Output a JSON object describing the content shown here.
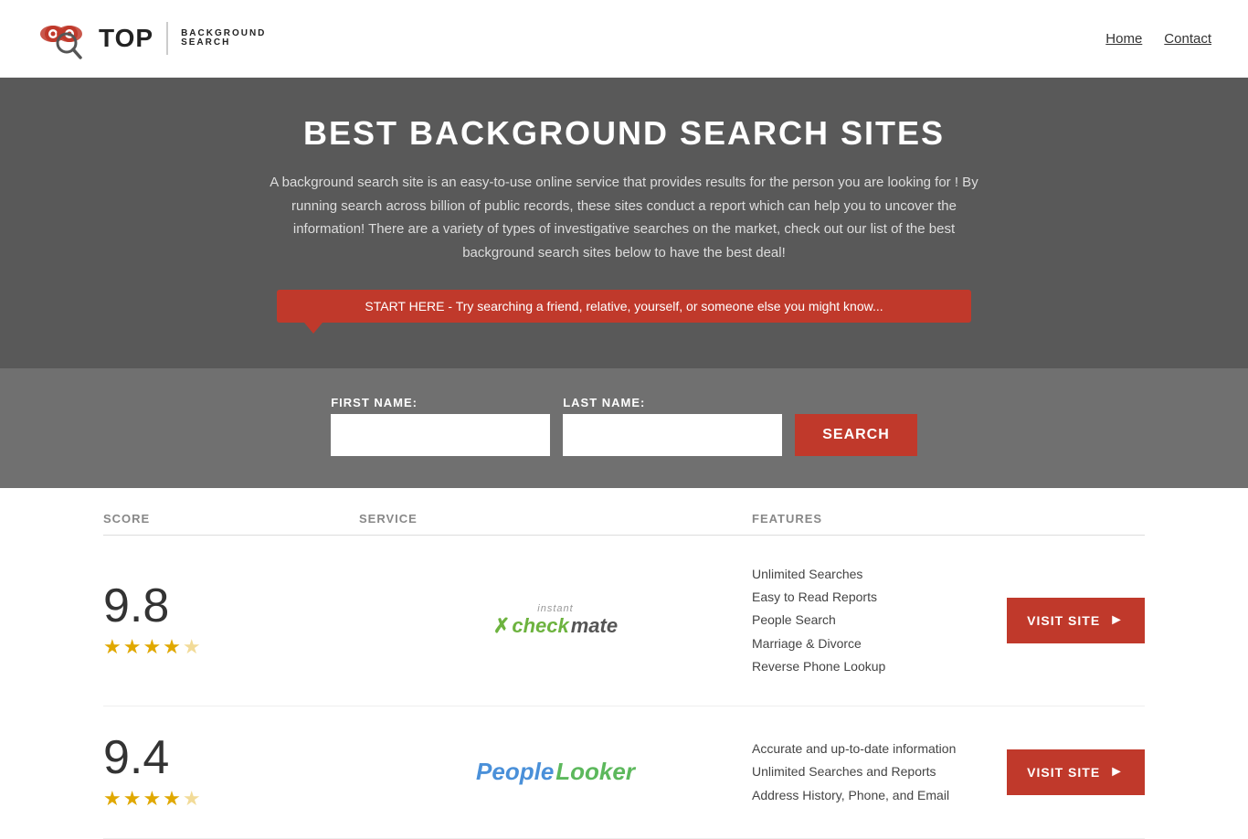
{
  "header": {
    "logo_top": "TOP",
    "logo_sub_line1": "BACKGROUND",
    "logo_sub_line2": "SEARCH",
    "nav": [
      {
        "label": "Home",
        "href": "#"
      },
      {
        "label": "Contact",
        "href": "#"
      }
    ]
  },
  "hero": {
    "title": "BEST BACKGROUND SEARCH SITES",
    "description": "A background search site is an easy-to-use online service that provides results  for the person you are looking for ! By  running  search across billion of public records, these sites conduct  a report which can help you to uncover the information! There are a variety of types of investigative searches on the market, check out our  list of the best background search sites below to have the best deal!",
    "speech_bubble": "START HERE - Try searching a friend, relative, yourself, or someone else you might know..."
  },
  "search": {
    "first_name_label": "FIRST NAME:",
    "last_name_label": "LAST NAME:",
    "button_label": "SEARCH"
  },
  "table": {
    "headers": {
      "score": "SCORE",
      "service": "SERVICE",
      "features": "FEATURES"
    },
    "rows": [
      {
        "score": "9.8",
        "stars": "★★★★★",
        "stars_count": 4.5,
        "service_name": "Instant Checkmate",
        "service_logo_type": "checkmate",
        "features": [
          "Unlimited Searches",
          "Easy to Read Reports",
          "People Search",
          "Marriage & Divorce",
          "Reverse Phone Lookup"
        ],
        "visit_label": "VISIT SITE"
      },
      {
        "score": "9.4",
        "stars": "★★★★★",
        "stars_count": 4.5,
        "service_name": "PeopleLooker",
        "service_logo_type": "peoplelooker",
        "features": [
          "Accurate and up-to-date information",
          "Unlimited Searches and Reports",
          "Address History, Phone, and Email"
        ],
        "visit_label": "VISIT SITE"
      }
    ]
  }
}
